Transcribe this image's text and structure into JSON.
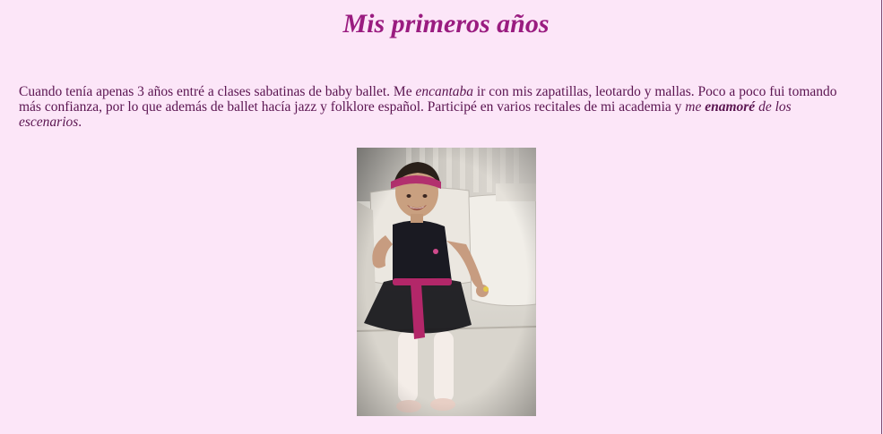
{
  "page": {
    "title": "Mis primeros años",
    "paragraph": {
      "part1": "Cuando tenía apenas 3 años entré a clases sabatinas de baby ballet. Me ",
      "em1": "encantaba",
      "part2": " ir con mis zapatillas, leotardo y mallas. Poco a poco fui tomando más confianza, por lo que además de ballet hacía jazz y folklore español. Participé en varios recitales de mi academia y ",
      "em2_pre": "me ",
      "em2_bold": "enamoré",
      "em2_post": " de los escenarios",
      "end": "."
    }
  },
  "colors": {
    "background": "#fce6f8",
    "title": "#9a1c80",
    "text": "#5a1450"
  }
}
